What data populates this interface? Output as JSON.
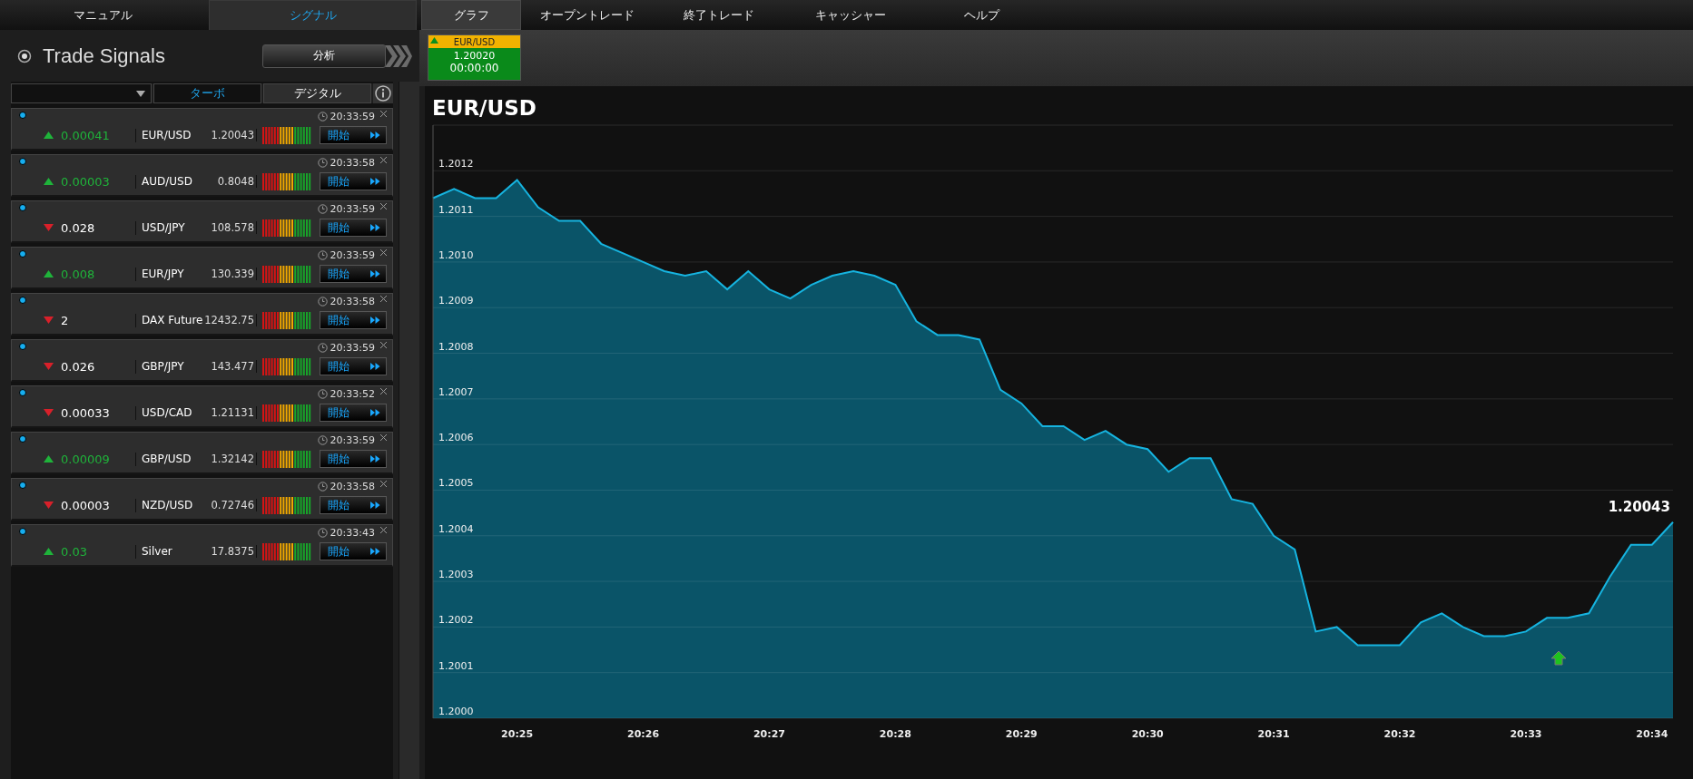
{
  "nav_left": [
    {
      "label": "マニュアル",
      "selected": false
    },
    {
      "label": "シグナル",
      "selected": true
    }
  ],
  "nav_main": [
    {
      "label": "グラフ",
      "selected": true
    },
    {
      "label": "オープントレード",
      "selected": false
    },
    {
      "label": "終了トレード",
      "selected": false
    },
    {
      "label": "キャッシャー",
      "selected": false
    },
    {
      "label": "ヘルプ",
      "selected": false
    }
  ],
  "panel": {
    "title": "Trade Signals",
    "analysis_button": "分析"
  },
  "filter_tabs": [
    {
      "label": "ターボ",
      "selected": true
    },
    {
      "label": "デジタル",
      "selected": false
    }
  ],
  "signals": [
    {
      "rising": true,
      "change": "0.00041",
      "symbol": "EUR/USD",
      "price": "1.20043",
      "time": "20:33:59",
      "action": "開始"
    },
    {
      "rising": true,
      "change": "0.00003",
      "symbol": "AUD/USD",
      "price": "0.8048",
      "time": "20:33:58",
      "action": "開始"
    },
    {
      "rising": false,
      "change": "0.028",
      "symbol": "USD/JPY",
      "price": "108.578",
      "time": "20:33:59",
      "action": "開始"
    },
    {
      "rising": true,
      "change": "0.008",
      "symbol": "EUR/JPY",
      "price": "130.339",
      "time": "20:33:59",
      "action": "開始"
    },
    {
      "rising": false,
      "change": "2",
      "symbol": "DAX Future",
      "price": "12432.75",
      "time": "20:33:58",
      "action": "開始"
    },
    {
      "rising": false,
      "change": "0.026",
      "symbol": "GBP/JPY",
      "price": "143.477",
      "time": "20:33:59",
      "action": "開始"
    },
    {
      "rising": false,
      "change": "0.00033",
      "symbol": "USD/CAD",
      "price": "1.21131",
      "time": "20:33:52",
      "action": "開始"
    },
    {
      "rising": true,
      "change": "0.00009",
      "symbol": "GBP/USD",
      "price": "1.32142",
      "time": "20:33:59",
      "action": "開始"
    },
    {
      "rising": false,
      "change": "0.00003",
      "symbol": "NZD/USD",
      "price": "0.72746",
      "time": "20:33:58",
      "action": "開始"
    },
    {
      "rising": true,
      "change": "0.03",
      "symbol": "Silver",
      "price": "17.8375",
      "time": "20:33:43",
      "action": "開始"
    }
  ],
  "quote_tab": {
    "rising": true,
    "symbol": "EUR/USD",
    "price": "1.20020",
    "timer": "00:00:00"
  },
  "chart": {
    "title": "EUR/USD",
    "current_price": "1.20043",
    "chart_data": {
      "type": "area",
      "categories": [
        null,
        null,
        null,
        null,
        "20:25",
        null,
        null,
        null,
        null,
        null,
        "20:26",
        null,
        null,
        null,
        null,
        null,
        "20:27",
        null,
        null,
        null,
        null,
        null,
        "20:28",
        null,
        null,
        null,
        null,
        null,
        "20:29",
        null,
        null,
        null,
        null,
        null,
        "20:30",
        null,
        null,
        null,
        null,
        null,
        "20:31",
        null,
        null,
        null,
        null,
        null,
        "20:32",
        null,
        null,
        null,
        null,
        null,
        "20:33",
        null,
        null,
        null,
        null,
        null,
        "20:34",
        null
      ],
      "grid": true,
      "series": [
        {
          "color": "#16b4e0",
          "values": [
            1.20114,
            1.20116,
            1.20114,
            1.20114,
            1.20118,
            1.20112,
            1.20109,
            1.20109,
            1.20104,
            1.20102,
            1.201,
            1.20098,
            1.20097,
            1.20098,
            1.20094,
            1.20098,
            1.20094,
            1.20092,
            1.20095,
            1.20097,
            1.20098,
            1.20097,
            1.20095,
            1.20087,
            1.20084,
            1.20084,
            1.20083,
            1.20072,
            1.20069,
            1.20064,
            1.20064,
            1.20061,
            1.20063,
            1.2006,
            1.20059,
            1.20054,
            1.20057,
            1.20057,
            1.20048,
            1.20047,
            1.2004,
            1.20037,
            1.20019,
            1.2002,
            1.20016,
            1.20016,
            1.20016,
            1.20021,
            1.20023,
            1.2002,
            1.20018,
            1.20018,
            1.20019,
            1.20022,
            1.20022,
            1.20023,
            1.20031,
            1.20038,
            1.20038,
            1.20043
          ]
        }
      ],
      "ylim": [
        1.2,
        1.2013
      ],
      "yticks": [
        {
          "value": 1.2,
          "label": "1.2000"
        },
        {
          "value": 1.2001,
          "label": "1.2001"
        },
        {
          "value": 1.2002,
          "label": "1.2002"
        },
        {
          "value": 1.2003,
          "label": "1.2003"
        },
        {
          "value": 1.2004,
          "label": "1.2004"
        },
        {
          "value": 1.2005,
          "label": "1.2005"
        },
        {
          "value": 1.2006,
          "label": "1.2006"
        },
        {
          "value": 1.2007,
          "label": "1.2007"
        },
        {
          "value": 1.2008,
          "label": "1.2008"
        },
        {
          "value": 1.2009,
          "label": "1.2009"
        },
        {
          "value": 1.201,
          "label": "1.2010"
        },
        {
          "value": 1.2011,
          "label": "1.2011"
        },
        {
          "value": 1.2012,
          "label": "1.2012"
        }
      ],
      "xlabel": null
    }
  }
}
